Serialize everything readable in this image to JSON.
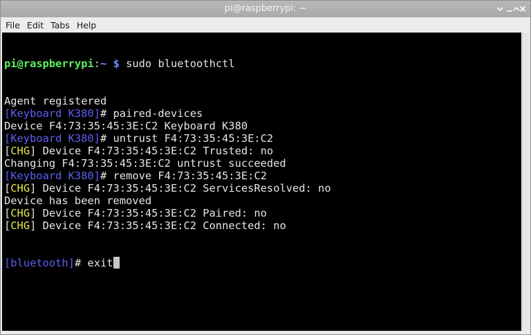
{
  "window": {
    "title": "pi@raspberrypi: ~"
  },
  "menu": [
    "File",
    "Edit",
    "Tabs",
    "Help"
  ],
  "terminal": {
    "prompt_user": "pi@raspberrypi",
    "prompt_sep": ":",
    "prompt_path": "~",
    "prompt_dollar": " $",
    "command": " sudo bluetoothctl",
    "lines": [
      {
        "segments": [
          {
            "text": "Agent registered",
            "color": "default"
          }
        ]
      },
      {
        "segments": [
          {
            "text": "[Keyboard K380]",
            "color": "blue"
          },
          {
            "text": "# paired-devices",
            "color": "default"
          }
        ]
      },
      {
        "segments": [
          {
            "text": "Device F4:73:35:45:3E:C2 Keyboard K380",
            "color": "default"
          }
        ]
      },
      {
        "segments": [
          {
            "text": "[Keyboard K380]",
            "color": "blue"
          },
          {
            "text": "# untrust F4:73:35:45:3E:C2",
            "color": "default"
          }
        ]
      },
      {
        "segments": [
          {
            "text": "[",
            "color": "default"
          },
          {
            "text": "CHG",
            "color": "yellow"
          },
          {
            "text": "] Device F4:73:35:45:3E:C2 Trusted: no",
            "color": "default"
          }
        ]
      },
      {
        "segments": [
          {
            "text": "Changing F4:73:35:45:3E:C2 untrust succeeded",
            "color": "default"
          }
        ]
      },
      {
        "segments": [
          {
            "text": "[Keyboard K380]",
            "color": "blue"
          },
          {
            "text": "# remove F4:73:35:45:3E:C2",
            "color": "default"
          }
        ]
      },
      {
        "segments": [
          {
            "text": "[",
            "color": "default"
          },
          {
            "text": "CHG",
            "color": "yellow"
          },
          {
            "text": "] Device F4:73:35:45:3E:C2 ServicesResolved: no",
            "color": "default"
          }
        ]
      },
      {
        "segments": [
          {
            "text": "Device has been removed",
            "color": "default"
          }
        ]
      },
      {
        "segments": [
          {
            "text": "[",
            "color": "default"
          },
          {
            "text": "CHG",
            "color": "yellow"
          },
          {
            "text": "] Device F4:73:35:45:3E:C2 Paired: no",
            "color": "default"
          }
        ]
      },
      {
        "segments": [
          {
            "text": "[",
            "color": "default"
          },
          {
            "text": "CHG",
            "color": "yellow"
          },
          {
            "text": "] Device F4:73:35:45:3E:C2 Connected: no",
            "color": "default"
          }
        ]
      }
    ],
    "input_prompt": "[bluetooth]",
    "input_hash": "# ",
    "input_text": "exit"
  },
  "colors": {
    "background": "#000000",
    "default_text": "#dcdcdc",
    "prompt_user": "#5ff05f",
    "prompt_path": "#6f8cff",
    "bracket_blue": "#5f5ff5",
    "chg_yellow": "#e8e84a"
  },
  "icons": {
    "collapse": "chevron-down-icon",
    "minimize": "minimize-icon",
    "maximize": "maximize-icon",
    "close": "close-icon"
  }
}
